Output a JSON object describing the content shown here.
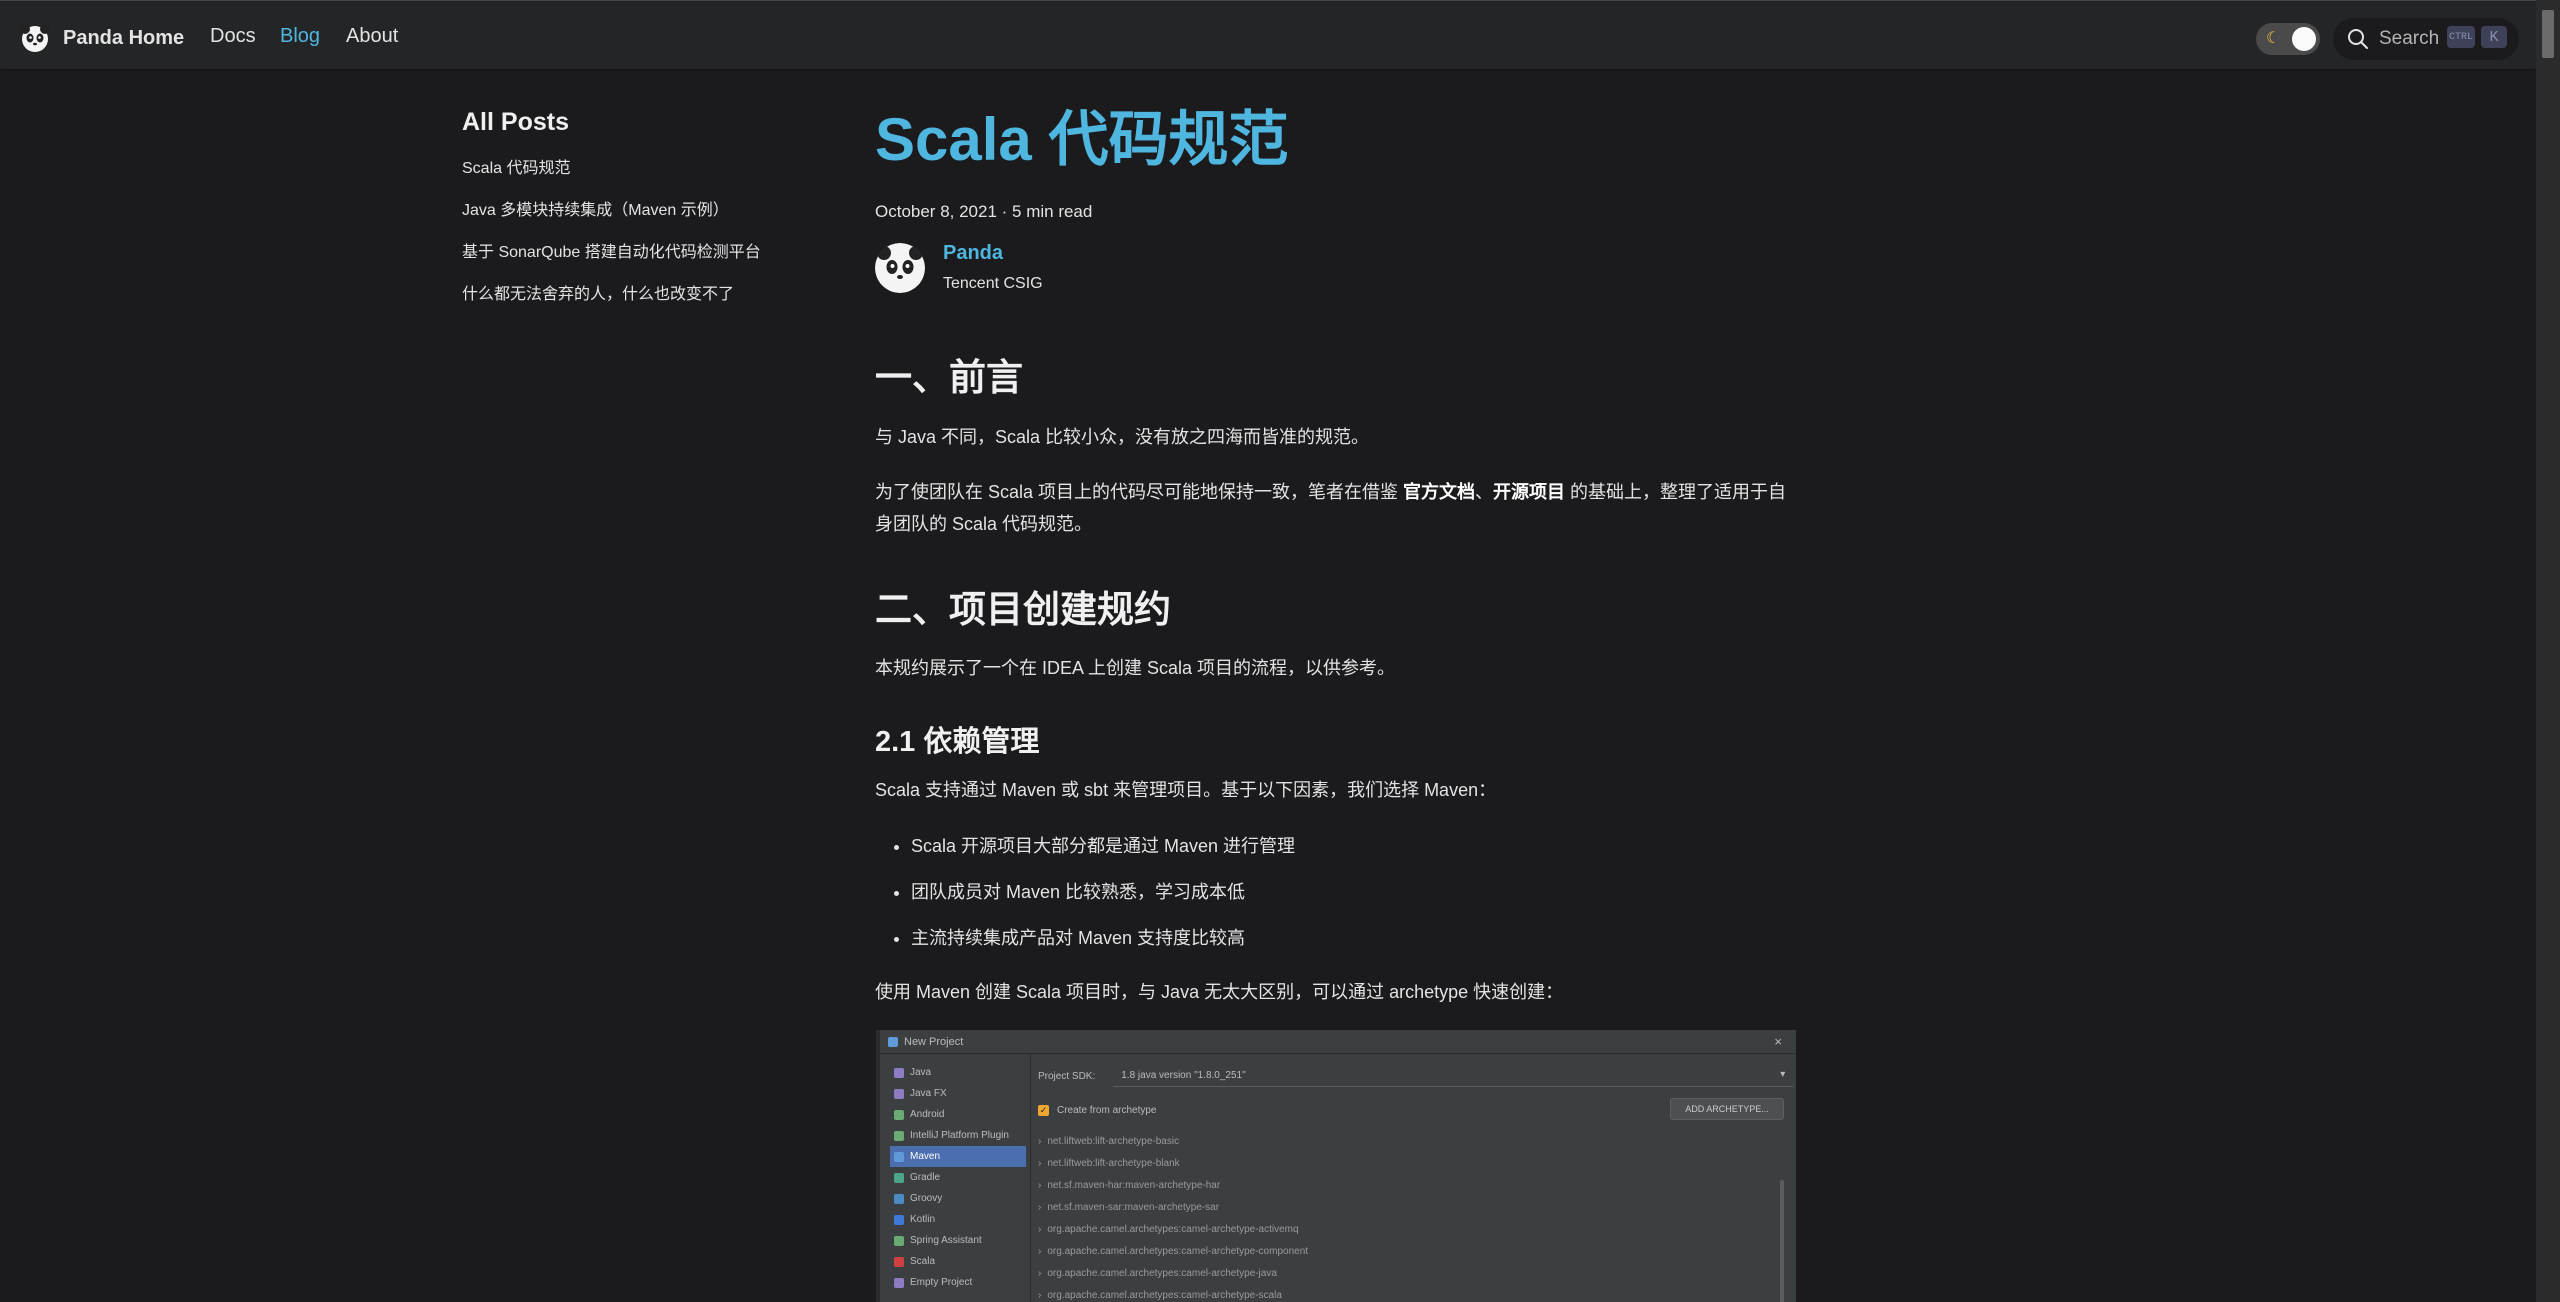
{
  "navbar": {
    "brand_title": "Panda Home",
    "links": [
      "Docs",
      "Blog",
      "About"
    ],
    "active_link": "Blog",
    "search_label": "Search",
    "kbd_ctrl": "CTRL",
    "kbd_k": "K"
  },
  "sidebar": {
    "title": "All Posts",
    "items": [
      "Scala 代码规范",
      "Java 多模块持续集成（Maven 示例）",
      "基于 SonarQube 搭建自动化代码检测平台",
      "什么都无法舍弃的人，什么也改变不了"
    ]
  },
  "post": {
    "title": "Scala 代码规范",
    "meta": "October 8, 2021 · 5 min read",
    "author_name": "Panda",
    "author_title": "Tencent CSIG"
  },
  "content": {
    "h1": "一、前言",
    "p1": "与 Java 不同，Scala 比较小众，没有放之四海而皆准的规范。",
    "p2_a": "为了使团队在 Scala 项目上的代码尽可能地保持一致，笔者在借鉴 ",
    "p2_b1": "官方文档",
    "p2_sep": "、",
    "p2_b2": "开源项目",
    "p2_c": " 的基础上，整理了适用于自身团队的 Scala 代码规范。",
    "h2": "二、项目创建规约",
    "p3": "本规约展示了一个在 IDEA 上创建 Scala 项目的流程，以供参考。",
    "h3": "2.1 依赖管理",
    "p4": "Scala 支持通过 Maven 或 sbt 来管理项目。基于以下因素，我们选择 Maven：",
    "bullets": [
      "Scala 开源项目大部分都是通过 Maven 进行管理",
      "团队成员对 Maven 比较熟悉，学习成本低",
      "主流持续集成产品对 Maven 支持度比较高"
    ],
    "p5": "使用 Maven 创建 Scala 项目时，与 Java 无太大区别，可以通过 archetype 快速创建："
  },
  "ide": {
    "window_title": "New Project",
    "close": "×",
    "project_types": [
      {
        "label": "Java",
        "color": "#8e7cc3"
      },
      {
        "label": "Java FX",
        "color": "#8e7cc3"
      },
      {
        "label": "Android",
        "color": "#6aab73"
      },
      {
        "label": "IntelliJ Platform Plugin",
        "color": "#6aab73"
      },
      {
        "label": "Maven",
        "color": "#5f9bd8"
      },
      {
        "label": "Gradle",
        "color": "#4aa58a"
      },
      {
        "label": "Groovy",
        "color": "#4a8bc4"
      },
      {
        "label": "Kotlin",
        "color": "#3f7bd6"
      },
      {
        "label": "Spring Assistant",
        "color": "#6aab73"
      },
      {
        "label": "Scala",
        "color": "#d04040"
      },
      {
        "label": "Empty Project",
        "color": "#8e7cc3"
      }
    ],
    "selected": "Maven",
    "sdk_label": "Project SDK:",
    "sdk_value": "1.8 java version \"1.8.0_251\"",
    "archetype_checkbox": "Create from archetype",
    "add_archetype": "ADD ARCHETYPE...",
    "archetypes": [
      "net.liftweb:lift-archetype-basic",
      "net.liftweb:lift-archetype-blank",
      "net.sf.maven-har:maven-archetype-har",
      "net.sf.maven-sar:maven-archetype-sar",
      "org.apache.camel.archetypes:camel-archetype-activemq",
      "org.apache.camel.archetypes:camel-archetype-component",
      "org.apache.camel.archetypes:camel-archetype-java",
      "org.apache.camel.archetypes:camel-archetype-scala"
    ]
  }
}
